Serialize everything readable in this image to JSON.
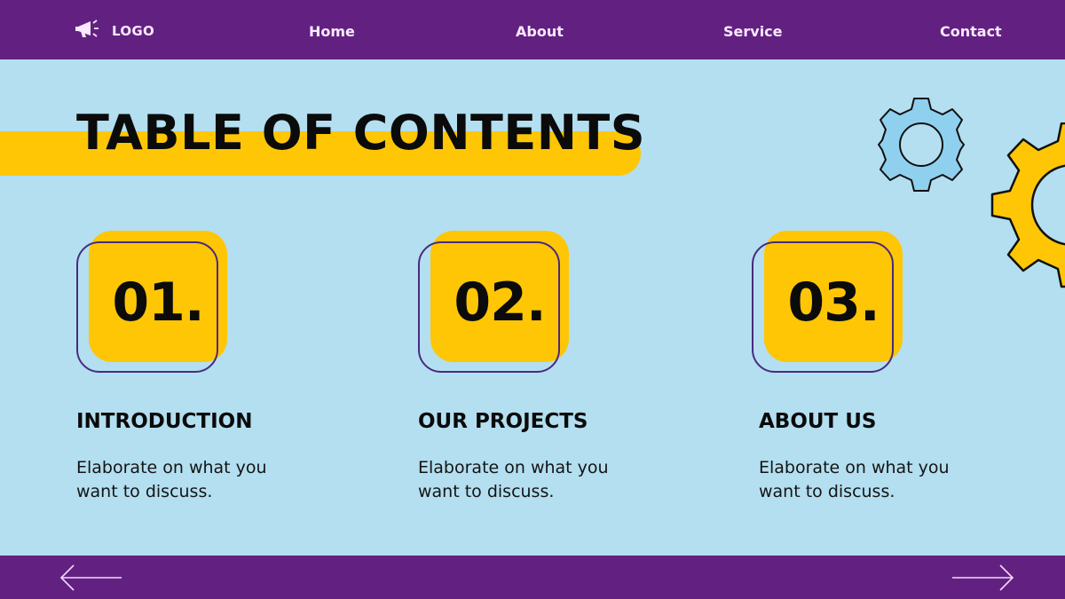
{
  "header": {
    "logo_icon": "megaphone-icon",
    "logo_label": "LOGO",
    "nav": [
      {
        "label": "Home"
      },
      {
        "label": "About"
      },
      {
        "label": "Service"
      },
      {
        "label": "Contact"
      }
    ]
  },
  "main": {
    "title": "TABLE OF CONTENTS",
    "sections": [
      {
        "number": "01.",
        "heading": "INTRODUCTION",
        "description": "Elaborate on what you want to discuss."
      },
      {
        "number": "02.",
        "heading": "OUR PROJECTS",
        "description": "Elaborate on what you want to discuss."
      },
      {
        "number": "03.",
        "heading": "ABOUT US",
        "description": "Elaborate on what you want to discuss."
      }
    ],
    "decorations": [
      "gear-icon-blue",
      "gear-icon-yellow"
    ]
  },
  "footer": {
    "prev_icon": "arrow-left-icon",
    "next_icon": "arrow-right-icon"
  },
  "colors": {
    "bar_purple": "#622181",
    "background": "#b3dff0",
    "accent_yellow": "#ffc605",
    "outline_purple": "#4a2a80",
    "gear_blue": "#8fd0ef"
  }
}
